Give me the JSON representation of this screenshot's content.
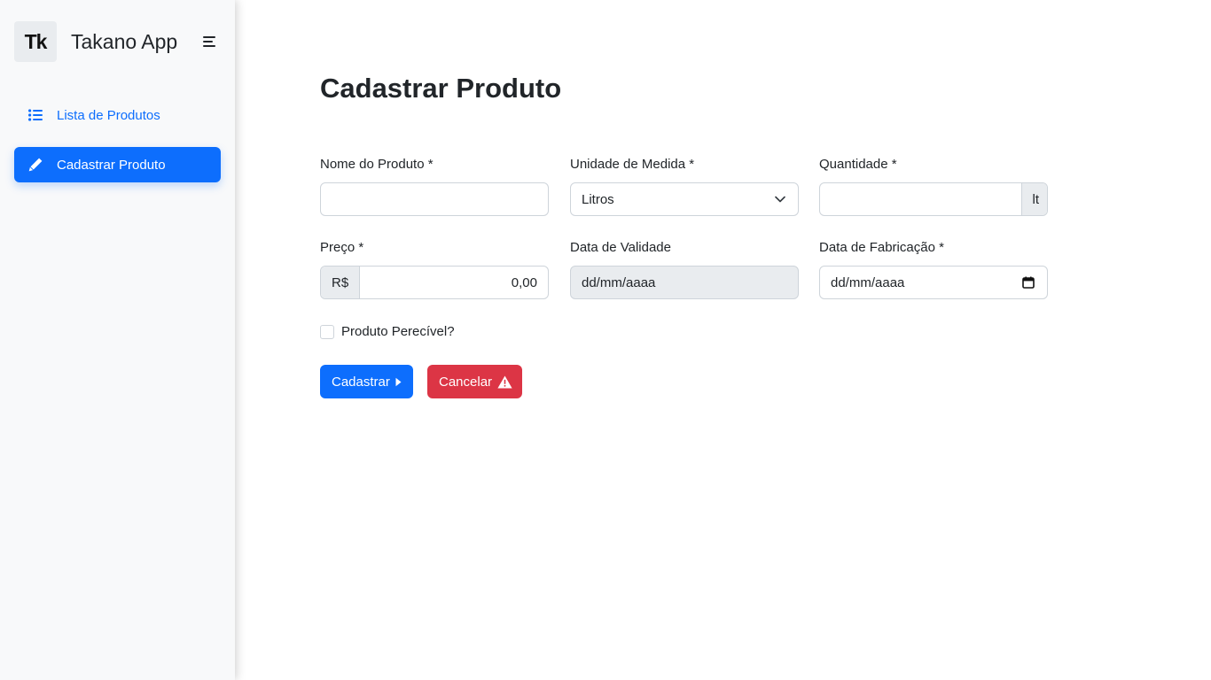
{
  "sidebar": {
    "logo_text": "Tk",
    "app_name": "Takano App",
    "items": [
      {
        "label": "Lista de Produtos",
        "icon": "list-icon"
      },
      {
        "label": "Cadastrar Produto",
        "icon": "pencil-icon",
        "active": true
      }
    ]
  },
  "page": {
    "title": "Cadastrar Produto"
  },
  "form": {
    "nome": {
      "label": "Nome do Produto *",
      "value": ""
    },
    "unidade": {
      "label": "Unidade de Medida *",
      "value": "Litros"
    },
    "quantidade": {
      "label": "Quantidade *",
      "value": "",
      "suffix": "lt"
    },
    "preco": {
      "label": "Preço *",
      "prefix": "R$",
      "value": "0,00"
    },
    "validade": {
      "label": "Data de Validade",
      "value": "dd/mm/aaaa"
    },
    "fabricacao": {
      "label": "Data de Fabricação *",
      "value": "dd/mm/aaaa"
    },
    "perecivel": {
      "label": "Produto Perecível?",
      "checked": false
    }
  },
  "buttons": {
    "submit": {
      "label": "Cadastrar",
      "icon": "caret-right-icon"
    },
    "cancel": {
      "label": "Cancelar",
      "icon": "warning-icon"
    }
  },
  "colors": {
    "primary": "#0d6efd",
    "danger": "#dc3545",
    "sidebar_bg": "#f8f9fa",
    "disabled_bg": "#e9ecef"
  }
}
